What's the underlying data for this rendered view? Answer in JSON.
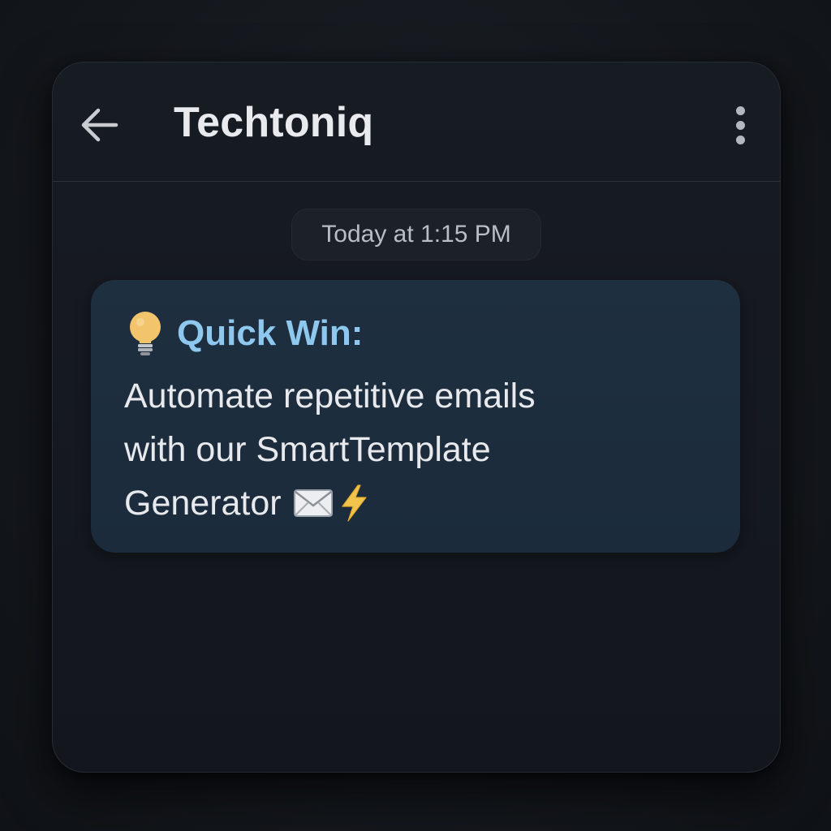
{
  "header": {
    "title": "Techtoniq",
    "back_icon": "arrow-left-icon",
    "menu_icon": "more-vertical-icon"
  },
  "timestamp": "Today at 1:15 PM",
  "message": {
    "icon": "lightbulb-icon",
    "title": "Quick Win:",
    "lines": [
      "Automate repetitive emails",
      "with our SmartTemplate",
      "Generator"
    ],
    "trailing_icons": [
      "envelope-icon",
      "lightning-bolt-icon"
    ]
  },
  "colors": {
    "background": "#15191e",
    "window": "#161a20",
    "bubble": "#1d2e3e",
    "accent": "#8fc8ef",
    "text": "#e7e9ec",
    "bulb": "#f2c46b",
    "bolt": "#f3c44d"
  }
}
